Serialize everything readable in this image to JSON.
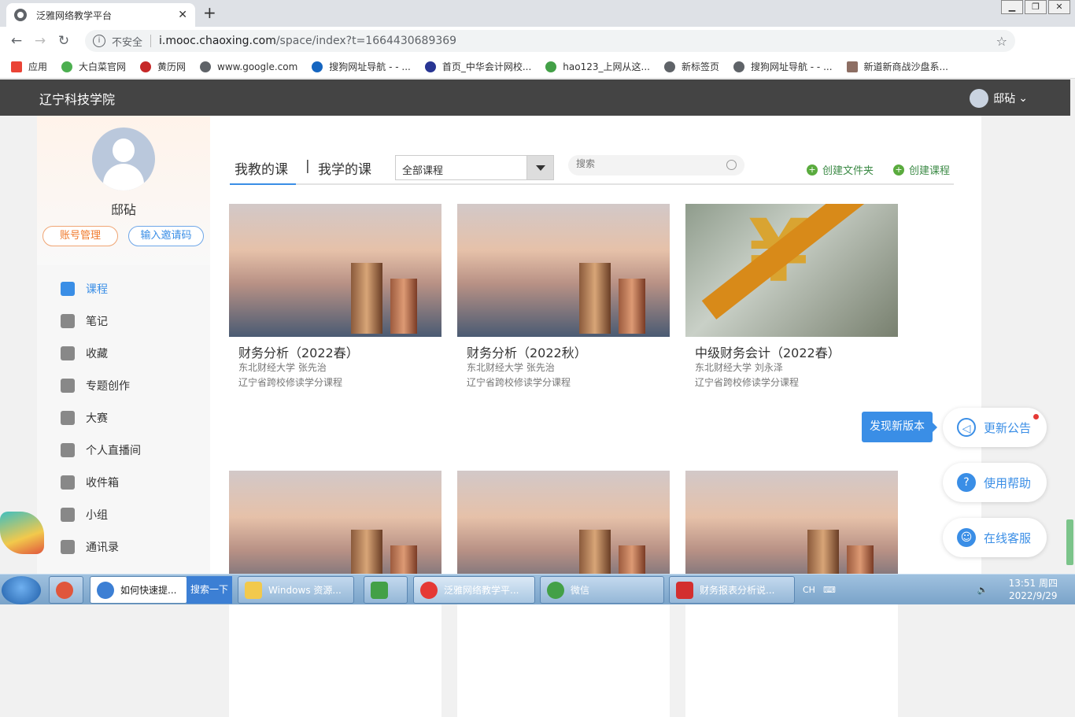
{
  "browser": {
    "tab_title": "泛雅网络教学平台",
    "tab_close": "✕",
    "new_tab": "+",
    "security": "不安全",
    "url_host": "i.mooc.chaoxing.com",
    "url_path": "/space/index?t=1664430689369",
    "nav_back": "←",
    "nav_forward": "→",
    "nav_reload": "↻",
    "star": "☆"
  },
  "bookmarks": [
    {
      "label": "应用",
      "color": "#ea4335"
    },
    {
      "label": "大白菜官网",
      "color": "#4caf50"
    },
    {
      "label": "黄历网",
      "color": "#c62828"
    },
    {
      "label": "www.google.com",
      "color": "#5f6368"
    },
    {
      "label": "搜狗网址导航 - - ...",
      "color": "#1565c0"
    },
    {
      "label": "首页_中华会计网校...",
      "color": "#283593"
    },
    {
      "label": "hao123_上网从这...",
      "color": "#43a047"
    },
    {
      "label": "新标签页",
      "color": "#5f6368"
    },
    {
      "label": "搜狗网址导航 - - ...",
      "color": "#5f6368"
    },
    {
      "label": "新道新商战沙盘系...",
      "color": "#8d6e63"
    }
  ],
  "header": {
    "school": "辽宁科技学院",
    "user": "邸砧",
    "dropdown_caret": "⌄"
  },
  "profile": {
    "name": "邸砧",
    "account_btn": "账号管理",
    "invite_btn": "输入邀请码"
  },
  "menu": [
    {
      "label": "课程",
      "icon": "course-icon"
    },
    {
      "label": "笔记",
      "icon": "note-icon"
    },
    {
      "label": "收藏",
      "icon": "favorite-icon"
    },
    {
      "label": "专题创作",
      "icon": "topic-icon"
    },
    {
      "label": "大赛",
      "icon": "contest-icon"
    },
    {
      "label": "个人直播间",
      "icon": "live-icon"
    },
    {
      "label": "收件箱",
      "icon": "inbox-icon"
    },
    {
      "label": "小组",
      "icon": "group-icon"
    },
    {
      "label": "通讯录",
      "icon": "contacts-icon"
    }
  ],
  "main": {
    "tab_teach": "我教的课",
    "tab_divider": "|",
    "tab_learn": "我学的课",
    "filter_value": "全部课程",
    "search_placeholder": "搜索",
    "new_folder": "创建文件夹",
    "new_course": "创建课程"
  },
  "courses": [
    {
      "title": "财务分析（2022春）",
      "teacher": "东北财经大学 张先治",
      "note": "辽宁省跨校修读学分课程"
    },
    {
      "title": "财务分析（2022秋）",
      "teacher": "东北财经大学 张先治",
      "note": "辽宁省跨校修读学分课程"
    },
    {
      "title": "中级财务会计（2022春）",
      "teacher": "东北财经大学 刘永泽",
      "note": "辽宁省跨校修读学分课程"
    }
  ],
  "widgets": {
    "new_version": "发现新版本",
    "announce": "更新公告",
    "help": "使用帮助",
    "service": "在线客服"
  },
  "taskbar": {
    "items": [
      "如何快速提...",
      "Windows 资源...",
      "泛雅网络教学平...",
      "微信",
      "财务报表分析说..."
    ],
    "ie_search": "搜索一下",
    "lang": "CH",
    "time": "13:51 周四",
    "date": "2022/9/29"
  }
}
